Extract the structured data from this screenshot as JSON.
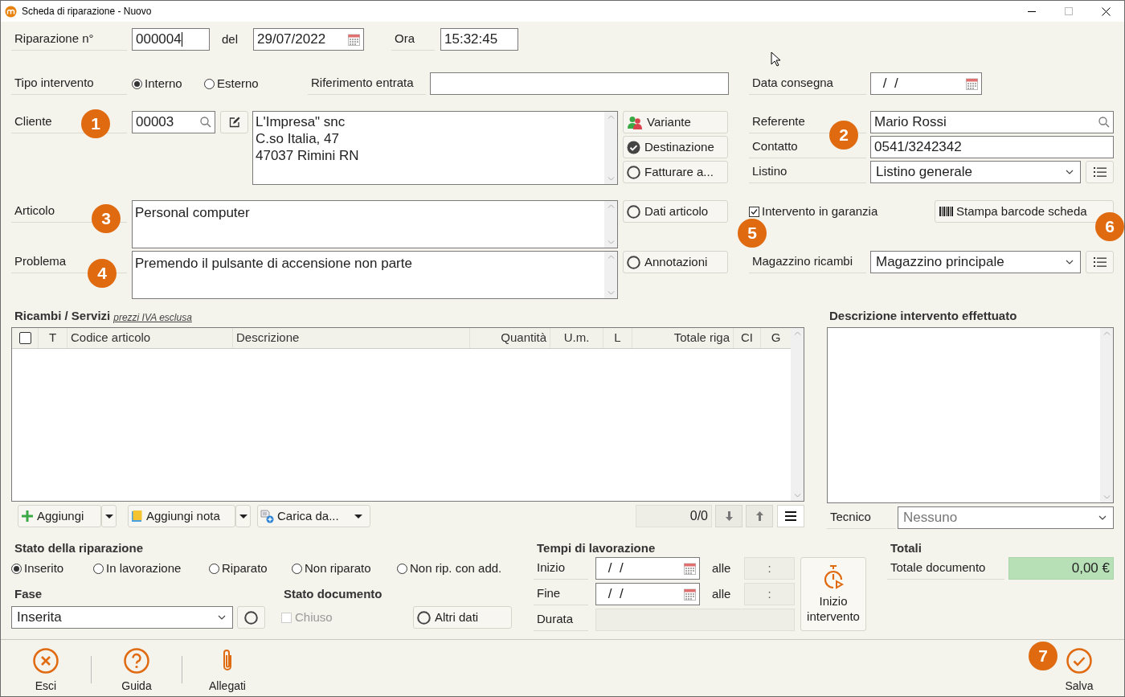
{
  "window": {
    "title": "Scheda di riparazione - Nuovo"
  },
  "header": {
    "number_label": "Riparazione n°",
    "number": "000004",
    "date_label": "del",
    "date": "29/07/2022",
    "time_label": "Ora",
    "time": "15:32:45"
  },
  "tipo_intervento": {
    "label": "Tipo intervento",
    "options": [
      {
        "label": "Interno",
        "selected": true
      },
      {
        "label": "Esterno",
        "selected": false
      }
    ]
  },
  "riferimento_entrata": {
    "label": "Riferimento entrata"
  },
  "data_consegna": {
    "label": "Data consegna",
    "value": " /  /"
  },
  "cliente": {
    "label": "Cliente",
    "code": "00003",
    "address": "L'Impresa\" snc\nC.so Italia, 47\n47037 Rimini RN"
  },
  "cliente_buttons": [
    {
      "kind": "people",
      "label": "Variante"
    },
    {
      "kind": "status",
      "label": "Destinazione",
      "checked": true
    },
    {
      "kind": "status",
      "label": "Fatturare a...",
      "checked": false
    }
  ],
  "referente": {
    "label": "Referente",
    "value": "Mario Rossi"
  },
  "contatto": {
    "label": "Contatto",
    "value": "0541/3242342"
  },
  "listino": {
    "label": "Listino",
    "value": "Listino generale"
  },
  "articolo": {
    "label": "Articolo",
    "value": "Personal computer",
    "button": {
      "label": "Dati articolo",
      "checked": false
    }
  },
  "problema": {
    "label": "Problema",
    "value": "Premendo il pulsante di accensione non parte",
    "button": {
      "label": "Annotazioni",
      "checked": false
    }
  },
  "garanzia": {
    "label": "Intervento in garanzia",
    "checked": true
  },
  "barcode_button": "Stampa barcode scheda",
  "magazzino": {
    "label": "Magazzino ricambi",
    "value": "Magazzino principale"
  },
  "ricambi": {
    "title": "Ricambi / Servizi",
    "note": "prezzi IVA esclusa",
    "select_all": {
      "checked": false
    },
    "columns": [
      "T",
      "Codice articolo",
      "Descrizione",
      "Quantità",
      "U.m.",
      "L",
      "Totale riga",
      "CI",
      "G"
    ],
    "toolbar": [
      {
        "kind": "add",
        "label": "Aggiungi"
      },
      {
        "kind": "note",
        "label": "Aggiungi nota"
      },
      {
        "kind": "load",
        "label": "Carica da..."
      }
    ],
    "counter": "0/0"
  },
  "descrizione": {
    "title": "Descrizione intervento effettuato"
  },
  "tecnico": {
    "label": "Tecnico",
    "value": "Nessuno"
  },
  "stato_riparazione": {
    "title": "Stato della riparazione",
    "options": [
      {
        "label": "Inserito",
        "selected": true
      },
      {
        "label": "In lavorazione",
        "selected": false
      },
      {
        "label": "Riparato",
        "selected": false
      },
      {
        "label": "Non riparato",
        "selected": false
      },
      {
        "label": "Non rip. con add.",
        "selected": false
      }
    ]
  },
  "fase": {
    "label": "Fase",
    "value": "Inserita",
    "button_checked": false
  },
  "stato_documento": {
    "title": "Stato documento",
    "chiuso": {
      "label": "Chiuso",
      "checked": false,
      "disabled": true
    },
    "altri_dati": {
      "label": "Altri dati",
      "checked": false
    }
  },
  "tempi": {
    "title": "Tempi di lavorazione",
    "rows": [
      {
        "label": "Inizio",
        "date": " /  /",
        "at": "alle",
        "time": ":"
      },
      {
        "label": "Fine",
        "date": " /  /",
        "at": "alle",
        "time": ":"
      }
    ],
    "durata": "Durata",
    "button": "Inizio intervento"
  },
  "totali": {
    "title": "Totali",
    "label": "Totale documento",
    "value": "0,00 €"
  },
  "footer": [
    {
      "kind": "close",
      "label": "Esci"
    },
    {
      "kind": "help",
      "label": "Guida"
    },
    {
      "kind": "clip",
      "label": "Allegati"
    },
    {
      "kind": "save",
      "label": "Salva"
    }
  ],
  "callouts": [
    "1",
    "2",
    "3",
    "4",
    "5",
    "6",
    "7"
  ]
}
